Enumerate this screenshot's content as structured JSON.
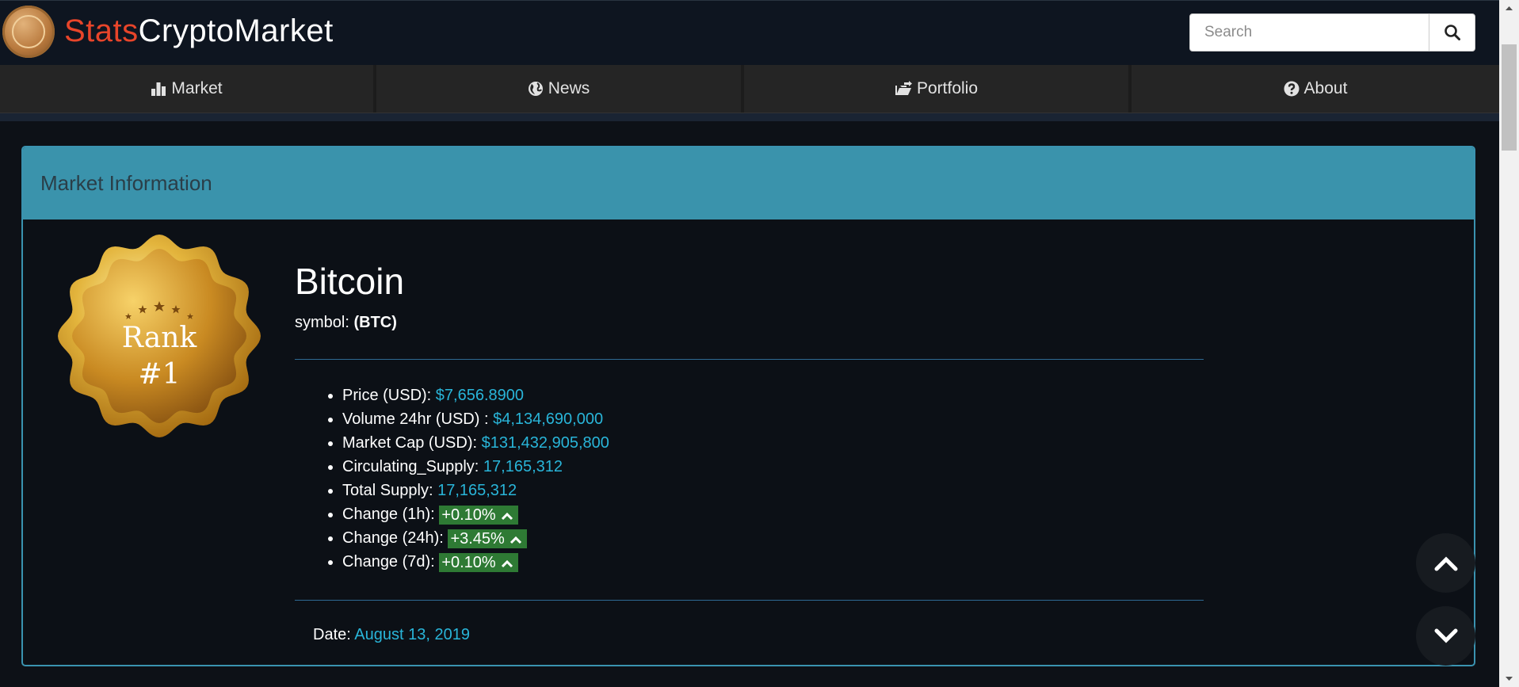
{
  "header": {
    "logo_part1": "Stats",
    "logo_part2": "CryptoMarket",
    "search_placeholder": "Search"
  },
  "nav": {
    "items": [
      {
        "label": "Market",
        "icon": "bar-chart-icon"
      },
      {
        "label": "News",
        "icon": "globe-icon"
      },
      {
        "label": "Portfolio",
        "icon": "folder-icon"
      },
      {
        "label": "About",
        "icon": "question-circle-icon"
      }
    ]
  },
  "panel": {
    "title": "Market Information",
    "badge": {
      "line1": "Rank",
      "line2": "#1"
    },
    "coin_name": "Bitcoin",
    "symbol_label": "symbol:",
    "symbol": "(BTC)",
    "stats": [
      {
        "label": "Price (USD):",
        "value": "$7,656.8900"
      },
      {
        "label": "Volume 24hr (USD) :",
        "value": "$4,134,690,000"
      },
      {
        "label": "Market Cap (USD):",
        "value": "$131,432,905,800"
      },
      {
        "label": "Circulating_Supply:",
        "value": "17,165,312"
      },
      {
        "label": "Total Supply:",
        "value": "17,165,312"
      }
    ],
    "changes": [
      {
        "label": "Change (1h):",
        "value": "+0.10%"
      },
      {
        "label": "Change (24h):",
        "value": "+3.45%"
      },
      {
        "label": "Change (7d):",
        "value": "+0.10%"
      }
    ],
    "date_label": "Date:",
    "date_value": "August 13, 2019"
  },
  "colors": {
    "accent": "#3a93ac",
    "value": "#29b5d9",
    "positive": "#2e7a34",
    "logo_red": "#e8452a"
  }
}
